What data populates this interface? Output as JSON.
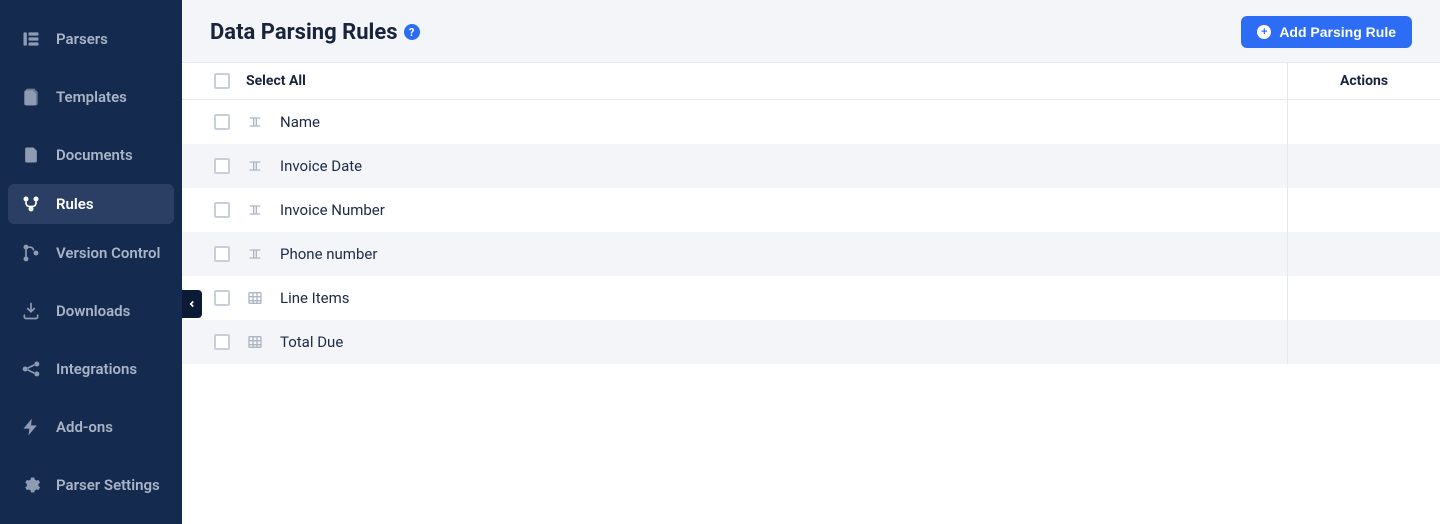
{
  "sidebar": {
    "items": [
      {
        "label": "Parsers",
        "icon": "parsers"
      },
      {
        "label": "Templates",
        "icon": "templates"
      },
      {
        "label": "Documents",
        "icon": "documents"
      },
      {
        "label": "Rules",
        "icon": "rules",
        "active": true
      },
      {
        "label": "Version Control",
        "icon": "version-control"
      },
      {
        "label": "Downloads",
        "icon": "downloads"
      },
      {
        "label": "Integrations",
        "icon": "integrations"
      },
      {
        "label": "Add-ons",
        "icon": "addons"
      },
      {
        "label": "Parser Settings",
        "icon": "settings"
      }
    ]
  },
  "header": {
    "title": "Data Parsing Rules",
    "help_tooltip": "?",
    "add_button_label": "Add Parsing Rule"
  },
  "table": {
    "select_all_label": "Select All",
    "actions_label": "Actions",
    "rows": [
      {
        "label": "Name",
        "type": "text"
      },
      {
        "label": "Invoice Date",
        "type": "text"
      },
      {
        "label": "Invoice Number",
        "type": "text"
      },
      {
        "label": "Phone number",
        "type": "text"
      },
      {
        "label": "Line Items",
        "type": "table"
      },
      {
        "label": "Total Due",
        "type": "table"
      }
    ]
  }
}
